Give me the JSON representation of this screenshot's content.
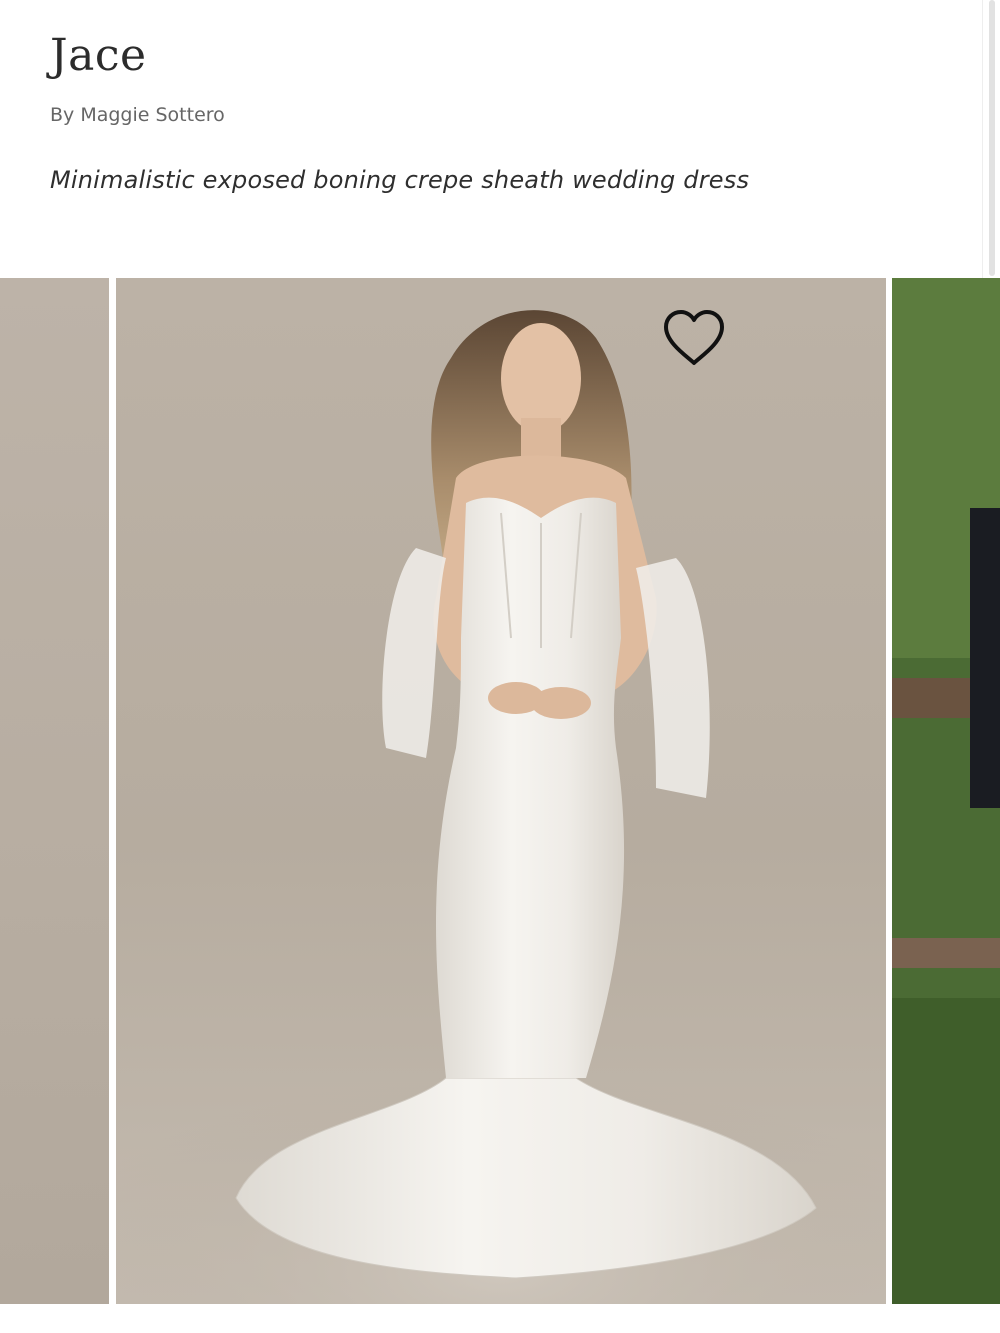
{
  "product": {
    "name": "Jace",
    "designer": "By Maggie Sottero",
    "description": "Minimalistic exposed boning crepe sheath wedding dress"
  },
  "gallery": {
    "slides": [
      {
        "position": "previous",
        "content": "partial studio photo"
      },
      {
        "position": "current",
        "content": "bride in off-shoulder crepe sheath gown with tulle bow sleeves and train"
      },
      {
        "position": "next",
        "content": "partial outdoor photo with greenery"
      }
    ]
  },
  "icons": {
    "favorite": "heart-outline-icon"
  },
  "colors": {
    "studio_backdrop": "#b8ae a2",
    "dress": "#f4f2ee",
    "foliage": "#3e5a2c"
  }
}
